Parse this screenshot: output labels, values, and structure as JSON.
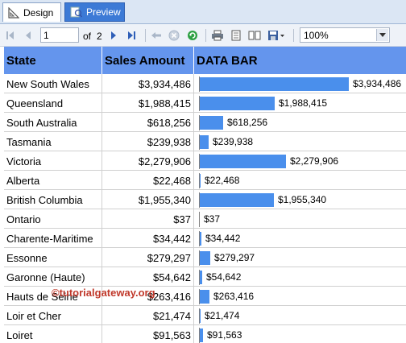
{
  "tabs": [
    {
      "label": "Design",
      "icon": "design-ruler-icon"
    },
    {
      "label": "Preview",
      "icon": "preview-icon"
    }
  ],
  "toolbar": {
    "page_current": "1",
    "page_of": "of",
    "page_total": "2",
    "zoom": "100%"
  },
  "report": {
    "headers": {
      "state": "State",
      "sales": "Sales Amount",
      "bar": "DATA BAR"
    },
    "rows": [
      {
        "state": "New South Wales",
        "sales": "$3,934,486",
        "value": 3934486
      },
      {
        "state": "Queensland",
        "sales": "$1,988,415",
        "value": 1988415
      },
      {
        "state": "South Australia",
        "sales": "$618,256",
        "value": 618256
      },
      {
        "state": "Tasmania",
        "sales": "$239,938",
        "value": 239938
      },
      {
        "state": "Victoria",
        "sales": "$2,279,906",
        "value": 2279906
      },
      {
        "state": "Alberta",
        "sales": "$22,468",
        "value": 22468
      },
      {
        "state": "British Columbia",
        "sales": "$1,955,340",
        "value": 1955340
      },
      {
        "state": "Ontario",
        "sales": "$37",
        "value": 37
      },
      {
        "state": "Charente-Maritime",
        "sales": "$34,442",
        "value": 34442
      },
      {
        "state": "Essonne",
        "sales": "$279,297",
        "value": 279297
      },
      {
        "state": "Garonne (Haute)",
        "sales": "$54,642",
        "value": 54642
      },
      {
        "state": "Hauts de Seine",
        "sales": "$263,416",
        "value": 263416
      },
      {
        "state": "Loir et Cher",
        "sales": "$21,474",
        "value": 21474
      },
      {
        "state": "Loiret",
        "sales": "$91,563",
        "value": 91563
      }
    ],
    "bar_max": 3934486,
    "bar_color": "#4a8fec",
    "header_color": "#6495ed"
  },
  "watermark": "©tutorialgateway.org"
}
